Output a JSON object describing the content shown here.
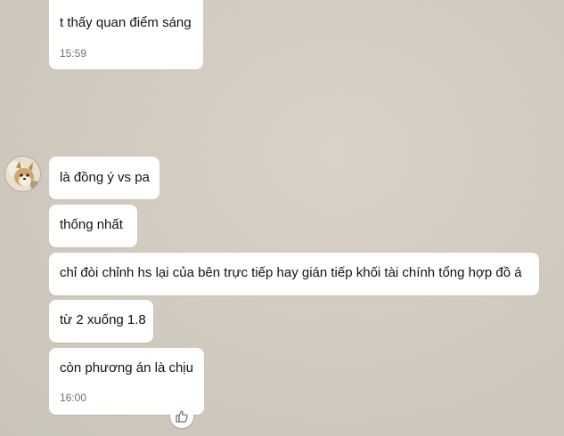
{
  "messages": [
    {
      "text": "t thấy quan điểm sáng",
      "time": "15:59"
    },
    {
      "text": "là đồng ý vs pa"
    },
    {
      "text": "thống nhất"
    },
    {
      "text": "chỉ đòi chỉnh hs lại của bên trực tiếp hay gián tiếp khối tài chính tổng hợp đồ á"
    },
    {
      "text": "từ 2 xuống 1.8"
    },
    {
      "text": "còn phương án là chịu",
      "time": "16:00"
    }
  ],
  "icons": {
    "avatar": "sender-avatar",
    "reaction": "thumbs-up-icon"
  },
  "colors": {
    "bubble": "#ffffff",
    "text": "#101215",
    "time": "#6b6f75"
  }
}
